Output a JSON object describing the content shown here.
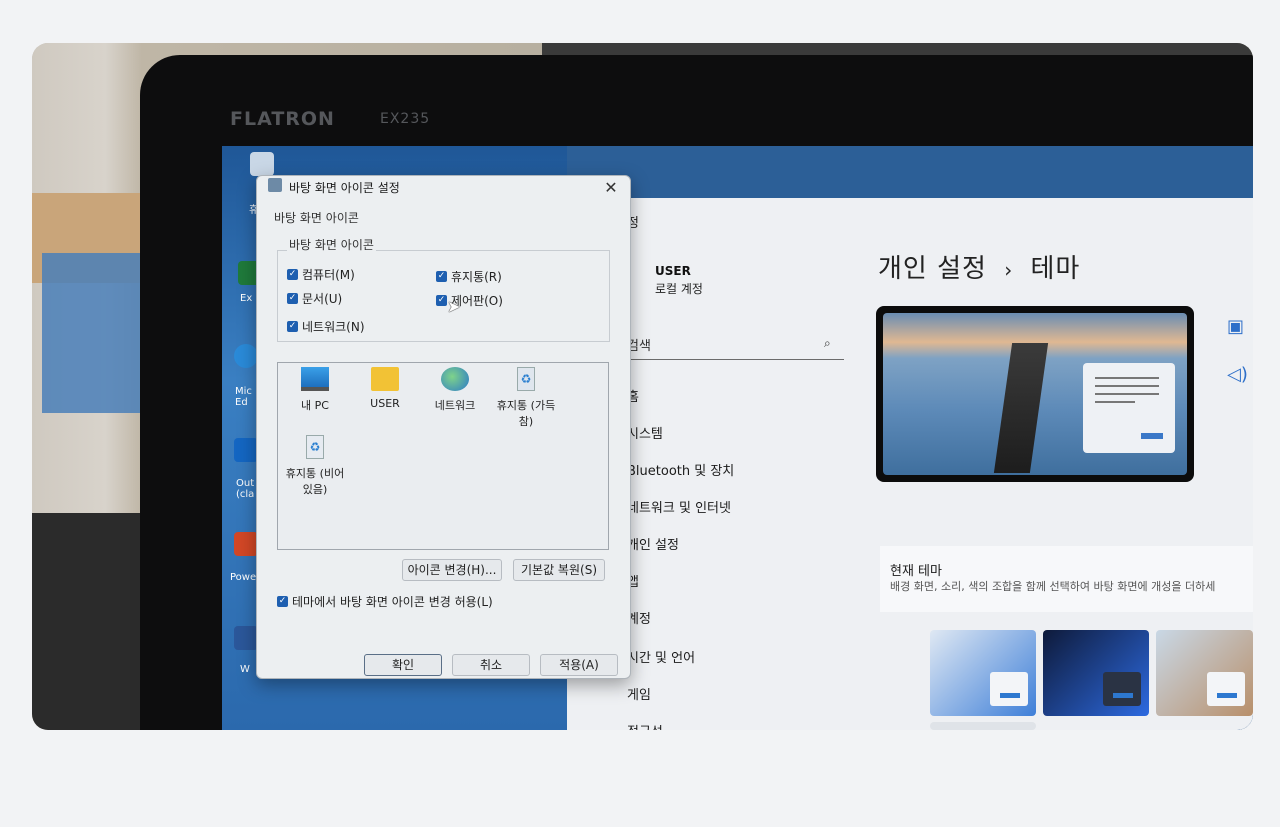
{
  "monitor": {
    "brand": "FLATRON",
    "model": "EX235"
  },
  "desktop": {
    "icons": [
      {
        "label": "휴",
        "color": "#c9d7e6"
      },
      {
        "label": "Ex",
        "color": "#1f7a3b"
      },
      {
        "label": "Mic Ed",
        "color": "#2a8ad8"
      },
      {
        "label": "Out (cla",
        "color": "#1466c2"
      },
      {
        "label": "Powe",
        "color": "#d24726"
      },
      {
        "label": "W",
        "color": "#2b579a"
      }
    ]
  },
  "settings": {
    "window_title_fragment": "정",
    "user": {
      "name": "USER",
      "subtitle": "로컬 계정"
    },
    "search": {
      "placeholder": "검색",
      "icon": "search-icon"
    },
    "nav": [
      "홈",
      "시스템",
      "Bluetooth 및 장치",
      "네트워크 및 인터넷",
      "개인 설정",
      "앱",
      "계정",
      "시간 및 언어",
      "게임",
      "접근성"
    ],
    "breadcrumb": {
      "parent": "개인 설정",
      "separator": "›",
      "current": "테마"
    },
    "current_theme": {
      "title": "현재 테마",
      "description": "배경 화면, 소리, 색의 조합을 함께 선택하여 바탕 화면에 개성을 더하세"
    },
    "side_icons": [
      "picture-icon",
      "speaker-icon"
    ],
    "account_icon": "account-icon"
  },
  "dialog": {
    "title": "바탕 화면 아이콘 설정",
    "close": "✕",
    "tab": "바탕 화면 아이콘",
    "group_label": "바탕 화면 아이콘",
    "checkboxes": [
      {
        "label": "컴퓨터(M)",
        "checked": true
      },
      {
        "label": "휴지통(R)",
        "checked": true
      },
      {
        "label": "문서(U)",
        "checked": true
      },
      {
        "label": "제어판(O)",
        "checked": true
      },
      {
        "label": "네트워크(N)",
        "checked": true
      }
    ],
    "icons": [
      {
        "label": "내 PC",
        "icon": "monitor-icon"
      },
      {
        "label": "USER",
        "icon": "folder-icon"
      },
      {
        "label": "네트워크",
        "icon": "network-icon"
      },
      {
        "label": "휴지통 (가득 참)",
        "icon": "recycle-bin-full-icon"
      },
      {
        "label": "휴지통 (비어 있음)",
        "icon": "recycle-bin-empty-icon"
      }
    ],
    "change_icon_button": "아이콘 변경(H)...",
    "restore_default_button": "기본값 복원(S)",
    "allow_theme_checkbox": {
      "label": "테마에서 바탕 화면 아이콘 변경 허용(L)",
      "checked": true
    },
    "ok_button": "확인",
    "cancel_button": "취소",
    "apply_button": "적용(A)"
  },
  "colors": {
    "accent": "#1e5fb0",
    "desktop": "#2f6aa8",
    "settings_bg": "#eef0f3"
  }
}
